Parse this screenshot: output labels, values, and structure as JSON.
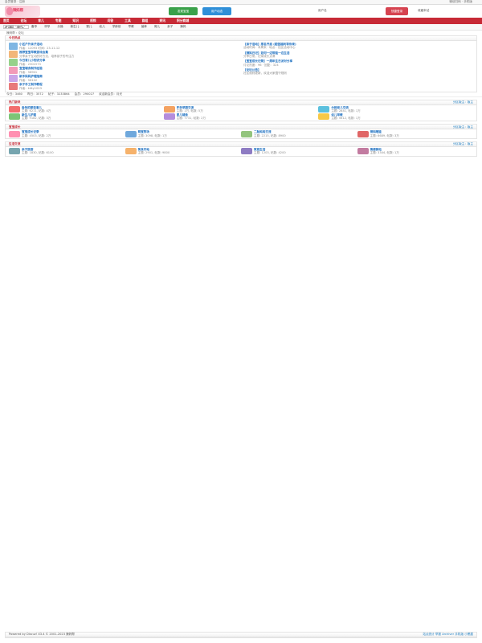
{
  "top": {
    "left": "会员登录 · 注册",
    "right": "微信扫码 · 手机版"
  },
  "header": {
    "logo": "辣妈帮",
    "btn1": "发现宝宝",
    "btn2": "用户动态",
    "link1": "用户名",
    "btn3": "快捷登录",
    "link2": "收藏本站"
  },
  "nav": [
    "首页",
    "论坛",
    "育儿",
    "专题",
    "知识",
    "视频",
    "问答",
    "工具",
    "群组",
    "资讯",
    "积分商城"
  ],
  "subnav": {
    "search_placeholder": "搜索",
    "items": [
      "备孕",
      "怀孕",
      "分娩",
      "新生儿",
      "婴儿",
      "幼儿",
      "学龄前",
      "早教",
      "营养",
      "育儿",
      "亲子",
      "辣妈"
    ]
  },
  "crumb": "辣妈帮 › 论坛",
  "header_title": "今日热点",
  "hot": {
    "title": "今日热点",
    "news": [
      {
        "t": "小区户外亲子活动",
        "s": "作者：12093  时间：23-11-12"
      },
      {
        "t": "推荐宝宝早教游戏合集",
        "s": "分享亲子互动的好方法，培养孩子的专注力"
      },
      {
        "t": "今日育儿小知识分享",
        "s": "作者：2301573"
      },
      {
        "t": "宝宝辅食制作经验",
        "s": "作者：58901"
      },
      {
        "t": "新手妈妈护理指南",
        "s": "作者：56102"
      },
      {
        "t": "亲子手工制作教程",
        "s": "作者：kitty1023"
      }
    ],
    "side": [
      {
        "t": "【亲子活动】报名开启 (超值福利等你来)",
        "s": "活动时间：本周末 · 地点：社区活动中心"
      },
      {
        "t": "【辣妈日记】如何一边带娃一边生活",
        "s": "分享日常，记录成长点滴"
      },
      {
        "t": "【宝宝成长记录】一周年生日派对分享",
        "s": "讨论热度：96 · 回复：324"
      },
      {
        "t": "【论坛公告】",
        "s": "社区规则更新，欢迎大家遵守规则"
      }
    ]
  },
  "stats": [
    "今日：3460",
    "昨日：3572",
    "帖子：3233864",
    "会员：290027",
    "欢迎新会员：月光"
  ],
  "sections": [
    {
      "title": "热门版块",
      "more": "分区版主：版主",
      "items": [
        {
          "n": "备孕的那些事儿",
          "s": "主题: 6211, 帖数: 4万"
        },
        {
          "n": "怀孕早期交流",
          "s": "主题: 1万, 帖数: 5万"
        },
        {
          "n": "分娩育儿交流",
          "s": "主题: 2841, 帖数: 1万"
        },
        {
          "n": "新生儿护理",
          "s": "主题: 9182, 帖数: 3万"
        },
        {
          "n": "婴儿辅食",
          "s": "主题: 7731, 帖数: 2万"
        },
        {
          "n": "幼儿早教",
          "s": "主题: 5612, 帖数: 1万"
        }
      ]
    },
    {
      "title": "宝宝成长",
      "more": "分区版主：版主",
      "items": [
        {
          "n": "宝宝成长记录",
          "s": "主题: 4503, 帖数: 2万"
        },
        {
          "n": "萌宝秀场",
          "s": "主题: 3098, 帖数: 1万"
        },
        {
          "n": "二胎妈妈交流",
          "s": "主题: 2215, 帖数: 8900"
        },
        {
          "n": "辣妈晒娃",
          "s": "主题: 6689, 帖数: 3万"
        }
      ]
    },
    {
      "title": "生活交流",
      "more": "分区版主：版主",
      "items": [
        {
          "n": "亲子旅游",
          "s": "主题: 1830, 帖数: 6100"
        },
        {
          "n": "美食天地",
          "s": "主题: 2901, 帖数: 9800"
        },
        {
          "n": "家居生活",
          "s": "主题: 1203, 帖数: 4200"
        },
        {
          "n": "情感驿站",
          "s": "主题: 3344, 帖数: 1万"
        }
      ]
    }
  ],
  "footer": {
    "copy": "Powered by Discuz! X3.4 © 2001-2023 辣妈帮",
    "links": [
      "站点统计",
      "举报",
      "Archiver",
      "手机版",
      "小黑屋"
    ]
  }
}
